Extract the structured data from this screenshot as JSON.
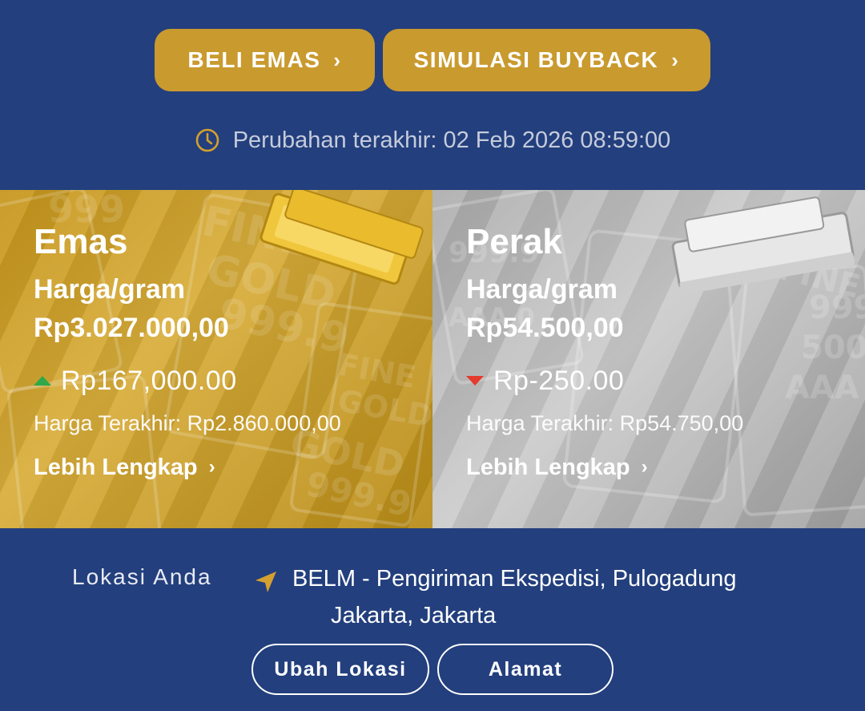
{
  "actions": {
    "buy_label": "BELI EMAS",
    "buyback_label": "SIMULASI BUYBACK",
    "chevron": "›"
  },
  "last_change": {
    "label": "Perubahan terakhir: 02 Feb 2026 08:59:00",
    "icon": "clock-icon"
  },
  "panels": [
    {
      "name": "Emas",
      "per_gram_label": "Harga/gram",
      "price": "Rp3.027.000,00",
      "change": "Rp167,000.00",
      "change_direction": "up",
      "last_price": "Harga Terakhir: Rp2.860.000,00",
      "more_label": "Lebih Lengkap",
      "indicator_color": "#2fa84a"
    },
    {
      "name": "Perak",
      "per_gram_label": "Harga/gram",
      "price": "Rp54.500,00",
      "change": "Rp-250.00",
      "change_direction": "down",
      "last_price": "Harga Terakhir: Rp54.750,00",
      "more_label": "Lebih Lengkap",
      "indicator_color": "#e53a2e"
    }
  ],
  "location": {
    "label": "Lokasi Anda",
    "line1": "BELM - Pengiriman Ekspedisi, Pulogadung",
    "line2": "Jakarta, Jakarta",
    "icon": "navigation-arrow-icon",
    "change_label": "Ubah Lokasi",
    "address_label": "Alamat"
  },
  "colors": {
    "background": "#233f7d",
    "gold_button": "#c99a2e",
    "accent_icon": "#d4a02f"
  }
}
